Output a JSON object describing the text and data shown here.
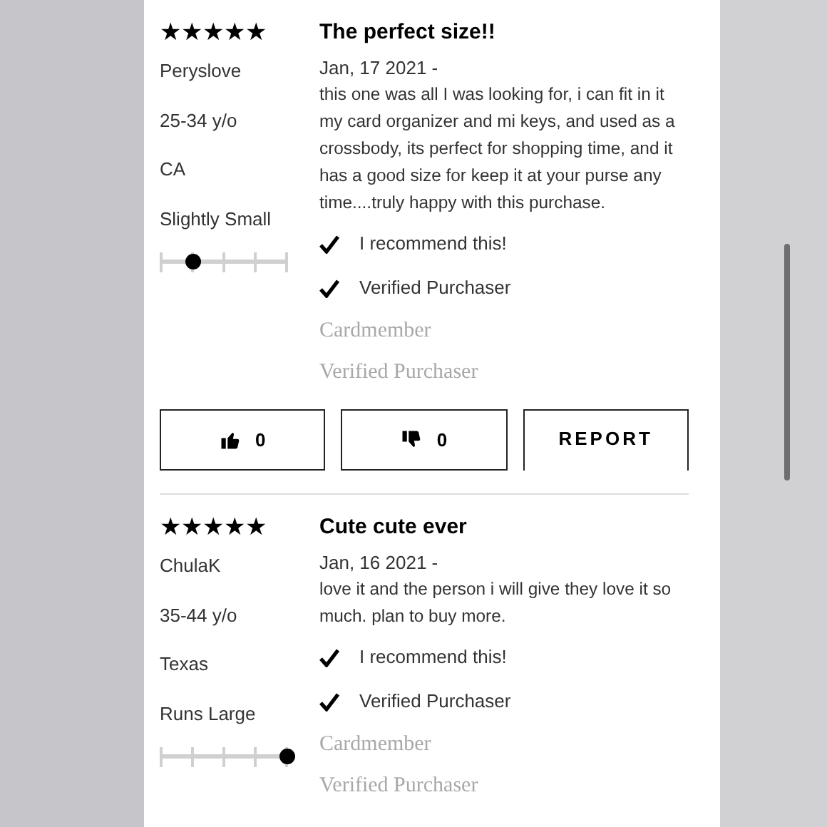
{
  "reviews": [
    {
      "stars": 5,
      "author": "Peryslove",
      "age": "25-34 y/o",
      "location": "CA",
      "fit": "Slightly Small",
      "fit_scale": {
        "level": 0.25
      },
      "title": "The perfect size!!",
      "date": "Jan, 17 2021 -",
      "body": "this one was all I was looking for, i can fit in it my card organizer and mi keys, and used as a crossbody, its perfect for shopping time, and it has a good size for keep it at your purse any time....truly happy with this purchase.",
      "checks": [
        {
          "label": "I recommend this!",
          "checked": true
        },
        {
          "label": "Verified Purchaser",
          "checked": true
        }
      ],
      "badges": [
        "Cardmember",
        "Verified Purchaser"
      ],
      "actions": [
        {
          "kind": "like",
          "count": "0"
        },
        {
          "kind": "dislike",
          "count": "0"
        },
        {
          "kind": "report",
          "label": "REPORT"
        }
      ]
    },
    {
      "stars": 5,
      "author": "ChulaK",
      "age": "35-44 y/o",
      "location": "Texas",
      "fit": "Runs Large",
      "fit_scale": {
        "level": 1
      },
      "title": "Cute cute ever",
      "date": "Jan, 16 2021 -",
      "body": "love it and the person i will give they love it so much. plan to buy more.",
      "checks": [
        {
          "label": "I recommend this!",
          "checked": true
        },
        {
          "label": "Verified Purchaser",
          "checked": true
        }
      ],
      "badges": [
        "Cardmember",
        "Verified Purchaser"
      ]
    }
  ]
}
